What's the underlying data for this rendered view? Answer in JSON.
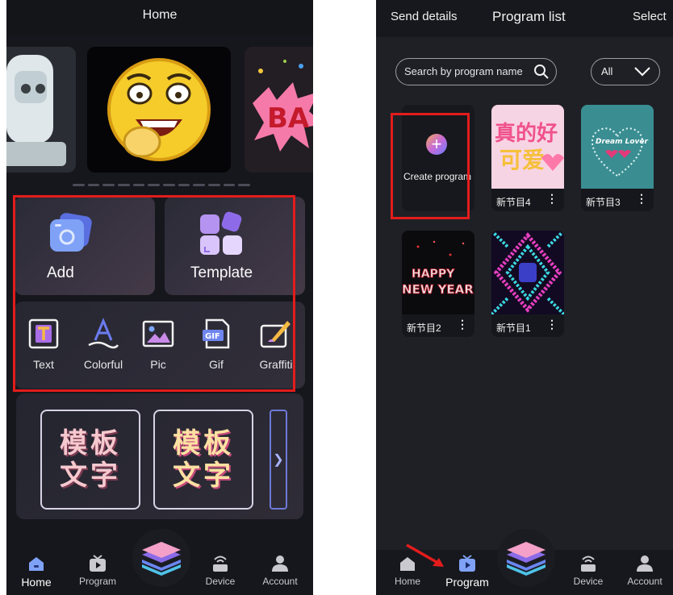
{
  "left_screen": {
    "header": {
      "title": "Home"
    },
    "features": {
      "add_label": "Add",
      "template_label": "Template"
    },
    "tools": [
      {
        "label": "Text",
        "icon": "text-icon"
      },
      {
        "label": "Colorful",
        "icon": "colorful-text-icon"
      },
      {
        "label": "Pic",
        "icon": "picture-icon"
      },
      {
        "label": "Gif",
        "icon": "gif-icon"
      },
      {
        "label": "Graffiti",
        "icon": "graffiti-icon"
      }
    ],
    "templates": [
      {
        "text": "模板文字"
      },
      {
        "text": "模板文字"
      }
    ],
    "tabbar": [
      {
        "label": "Home",
        "icon": "home-icon",
        "active": true
      },
      {
        "label": "Program",
        "icon": "program-icon",
        "active": false
      },
      {
        "label": "Device",
        "icon": "device-icon",
        "active": false
      },
      {
        "label": "Account",
        "icon": "account-icon",
        "active": false
      }
    ]
  },
  "right_screen": {
    "header": {
      "left_action": "Send details",
      "title": "Program list",
      "right_action": "Select"
    },
    "search": {
      "placeholder": "Search by program name"
    },
    "filter": {
      "value": "All"
    },
    "create_program": {
      "label": "Create program"
    },
    "programs": [
      {
        "name": "新节目4"
      },
      {
        "name": "新节目3"
      },
      {
        "name": "新节目2"
      },
      {
        "name": "新节目1"
      }
    ],
    "tabbar": [
      {
        "label": "Home",
        "icon": "home-icon",
        "active": false
      },
      {
        "label": "Program",
        "icon": "program-icon",
        "active": true
      },
      {
        "label": "Device",
        "icon": "device-icon",
        "active": false
      },
      {
        "label": "Account",
        "icon": "account-icon",
        "active": false
      }
    ]
  },
  "colors": {
    "highlight_box": "#e31c1c",
    "background": "#16171c",
    "panel": "#1f2026",
    "accent_gradient": [
      "#f2a65a",
      "#c86ad6",
      "#6c7bff"
    ]
  }
}
